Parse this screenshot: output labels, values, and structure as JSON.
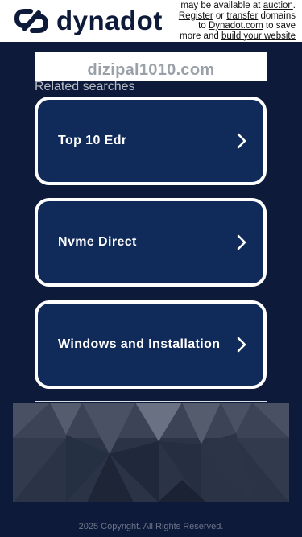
{
  "header": {
    "logo_text": "dynadot",
    "promo": {
      "line1_pre": "may be available at ",
      "auction_link": "auction",
      "line1_post": ".",
      "register_link": "Register",
      "or_text": " or ",
      "transfer_link": "transfer",
      "domains_text": " domains",
      "to_text": "to ",
      "dynadot_link": "Dynadot.com",
      "save_text": " to save",
      "more_text": "more and ",
      "build_link": "build your website"
    }
  },
  "domain": {
    "name": "dizipal1010.com"
  },
  "related": {
    "heading": "Related searches",
    "items": [
      {
        "label": "Top 10 Edr"
      },
      {
        "label": "Nvme Direct"
      },
      {
        "label": "Windows and Installation"
      }
    ]
  },
  "footer": {
    "copyright": "2025 Copyright. All Rights Reserved."
  },
  "colors": {
    "background": "#0d1a3a",
    "button_fill": "#102a5a",
    "button_border": "#ffffff",
    "brand": "#0d1a3a"
  }
}
